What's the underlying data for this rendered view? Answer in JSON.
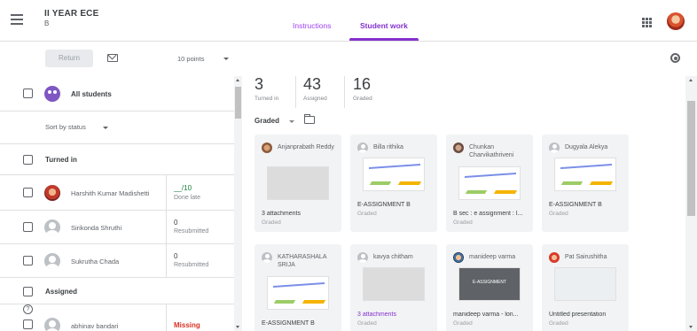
{
  "header": {
    "class_title": "II YEAR ECE",
    "class_section": "B",
    "tabs": [
      "Instructions",
      "Student work"
    ]
  },
  "toolbar": {
    "return_label": "Return",
    "points": "10 points"
  },
  "roster": {
    "all_students": "All students",
    "sort_label": "Sort by status",
    "turned_in_heading": "Turned in",
    "assigned_heading": "Assigned",
    "students": [
      {
        "name": "Harshith Kumar Madishetti",
        "grade": "__/10",
        "status": "Done late"
      },
      {
        "name": "Sirikonda Shruthi",
        "grade": "0",
        "status": "Resubmitted"
      },
      {
        "name": "Sukrutha Chada",
        "grade": "0",
        "status": "Resubmitted"
      },
      {
        "name": "abhinav bandari",
        "grade": "Missing",
        "status": ""
      }
    ]
  },
  "stats": [
    {
      "value": "3",
      "label": "Turned in"
    },
    {
      "value": "43",
      "label": "Assigned"
    },
    {
      "value": "16",
      "label": "Graded"
    }
  ],
  "filter": {
    "label": "Graded"
  },
  "cards": [
    {
      "name": "Anjanprabath Reddy",
      "line1": "3 attachments",
      "line2": "Graded"
    },
    {
      "name": "Billa rithika",
      "line1": "E-ASSIGNMENT B",
      "line2": "Graded"
    },
    {
      "name": "Chunkan Charvikathriveni",
      "line1": "B sec : e assignment : I...",
      "line2": "Graded"
    },
    {
      "name": "Dugyala Alekya",
      "line1": "E-ASSIGNMENT B",
      "line2": "Graded"
    },
    {
      "name": "KATHARASHALA SRIJA",
      "line1": "E-ASSIGNMENT B",
      "line2": ""
    },
    {
      "name": "kavya chitham",
      "line1": "3 attachments",
      "line2": "Graded"
    },
    {
      "name": "manideep varma",
      "line1": "manideep varma - lon...",
      "line2": "Graded",
      "thumb_text": "E-ASSIGNMENT"
    },
    {
      "name": "Pat Sairushitha",
      "line1": "Untitled presentation",
      "line2": "Graded"
    }
  ],
  "colors": {
    "accent": "#8430ce",
    "missing": "#d93025",
    "grade_green": "#188038"
  }
}
